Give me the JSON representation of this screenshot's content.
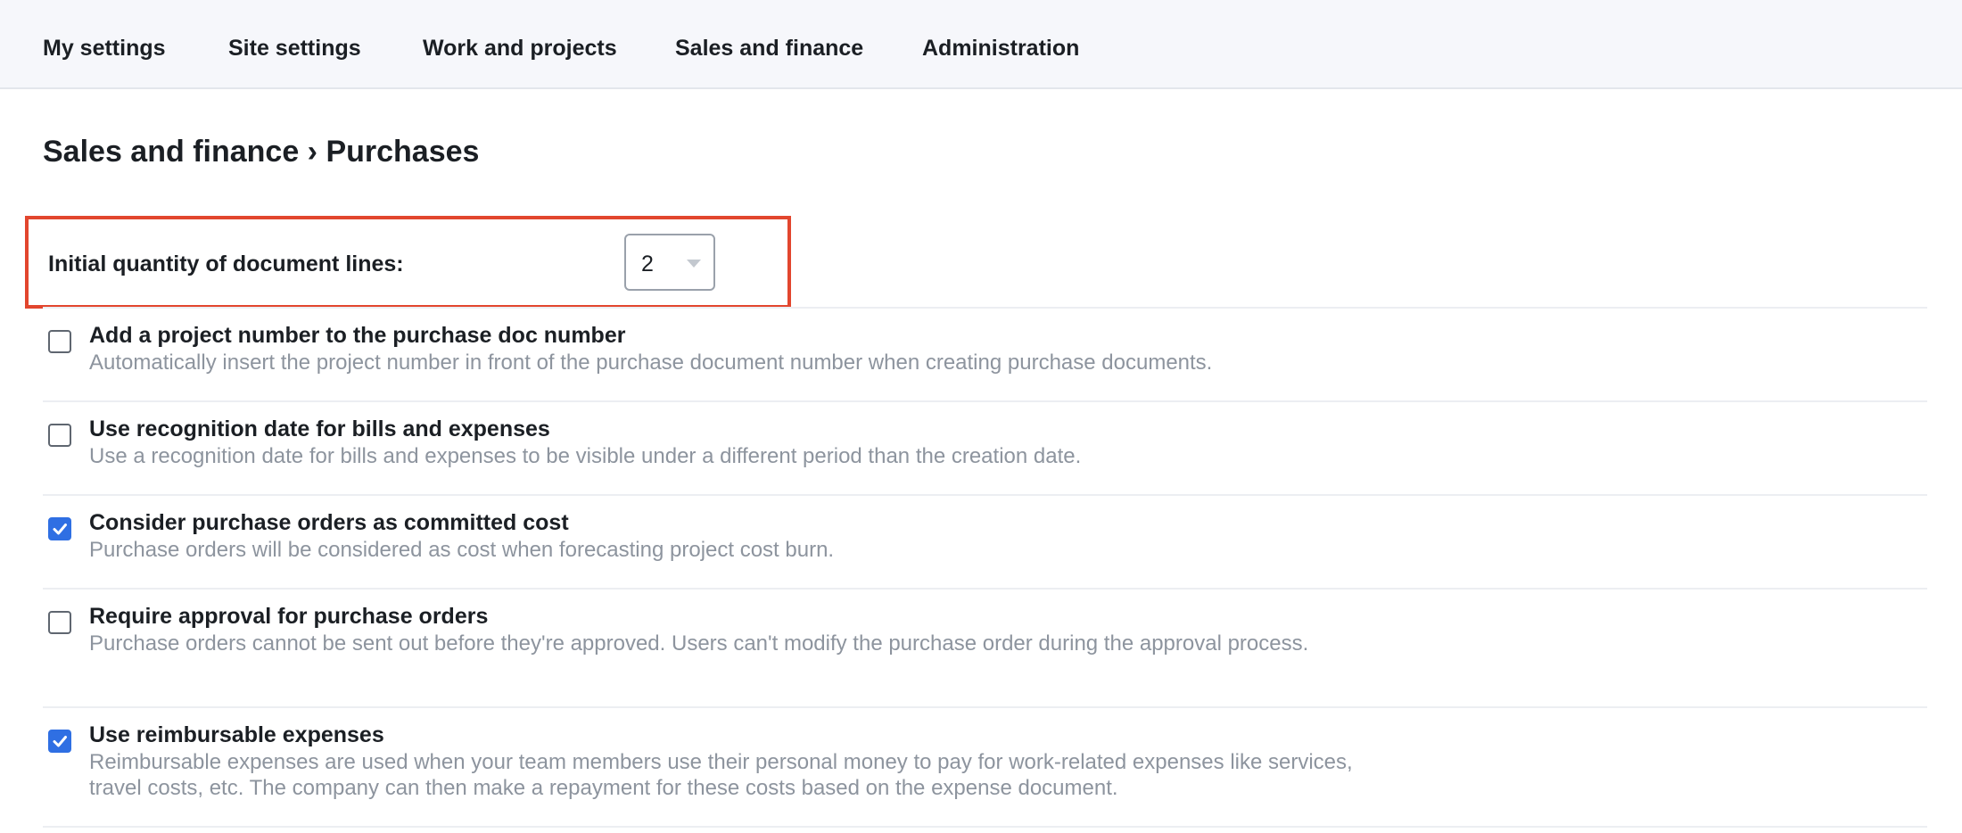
{
  "nav": {
    "items": [
      {
        "label": "My settings"
      },
      {
        "label": "Site settings"
      },
      {
        "label": "Work and projects"
      },
      {
        "label": "Sales and finance"
      },
      {
        "label": "Administration"
      }
    ]
  },
  "page": {
    "title": "Sales and finance › Purchases"
  },
  "quantity": {
    "label": "Initial quantity of document lines:",
    "value": "2"
  },
  "options": [
    {
      "title": "Add a project number to the purchase doc number",
      "description": "Automatically insert the project number in front of the purchase document number when creating purchase documents.",
      "checked": false
    },
    {
      "title": "Use recognition date for bills and expenses",
      "description": "Use a recognition date for bills and expenses to be visible under a different period than the creation date.",
      "checked": false
    },
    {
      "title": "Consider purchase orders as committed cost",
      "description": "Purchase orders will be considered as cost when forecasting project cost burn.",
      "checked": true
    },
    {
      "title": "Require approval for purchase orders",
      "description": "Purchase orders cannot be sent out before they're approved. Users can't modify the purchase order during the approval process.",
      "checked": false
    },
    {
      "title": "Use reimbursable expenses",
      "description": "Reimbursable expenses are used when your team members use their personal money to pay for work-related expenses like services, travel costs, etc. The company can then make a repayment for these costs based on the expense document.",
      "checked": true
    }
  ],
  "colors": {
    "accent": "#2f6fe3",
    "highlight": "#e2462e"
  }
}
